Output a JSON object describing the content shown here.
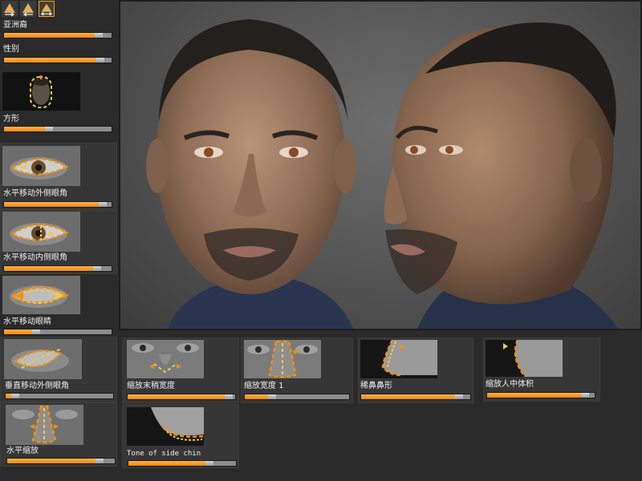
{
  "toolbar": {
    "icons": [
      "arrow-right-icon",
      "arrow-left-icon",
      "arrow-both-icon"
    ]
  },
  "left_panel": {
    "sliders": [
      {
        "label": "亚洲裔",
        "value": 0.84
      },
      {
        "label": "性别",
        "value": 0.86
      },
      {
        "label": "方形",
        "value": 0.38
      },
      {
        "label": "水平移动外侧眼角",
        "value": 0.88
      },
      {
        "label": "水平移动内侧眼角",
        "value": 0.83
      },
      {
        "label": "水平移动眼睛",
        "value": 0.26
      },
      {
        "label": "垂直移动外侧眼角",
        "value": 0.05
      },
      {
        "label": "水平缩放",
        "value": 0.82
      }
    ]
  },
  "bottom_panel": {
    "sliders": [
      {
        "label": "缩放末稍宽度",
        "value": 0.9
      },
      {
        "label": "缩放宽度 1",
        "value": 0.22
      },
      {
        "label": "稀鼻鼻形",
        "value": 0.86
      },
      {
        "label": "缩放人中体积",
        "value": 0.87
      },
      {
        "label": "Tone of side chin",
        "value": 0.72
      }
    ]
  },
  "colors": {
    "accent": "#f0900f",
    "guide": "#f2c94c",
    "background": "#2a2a2a"
  }
}
